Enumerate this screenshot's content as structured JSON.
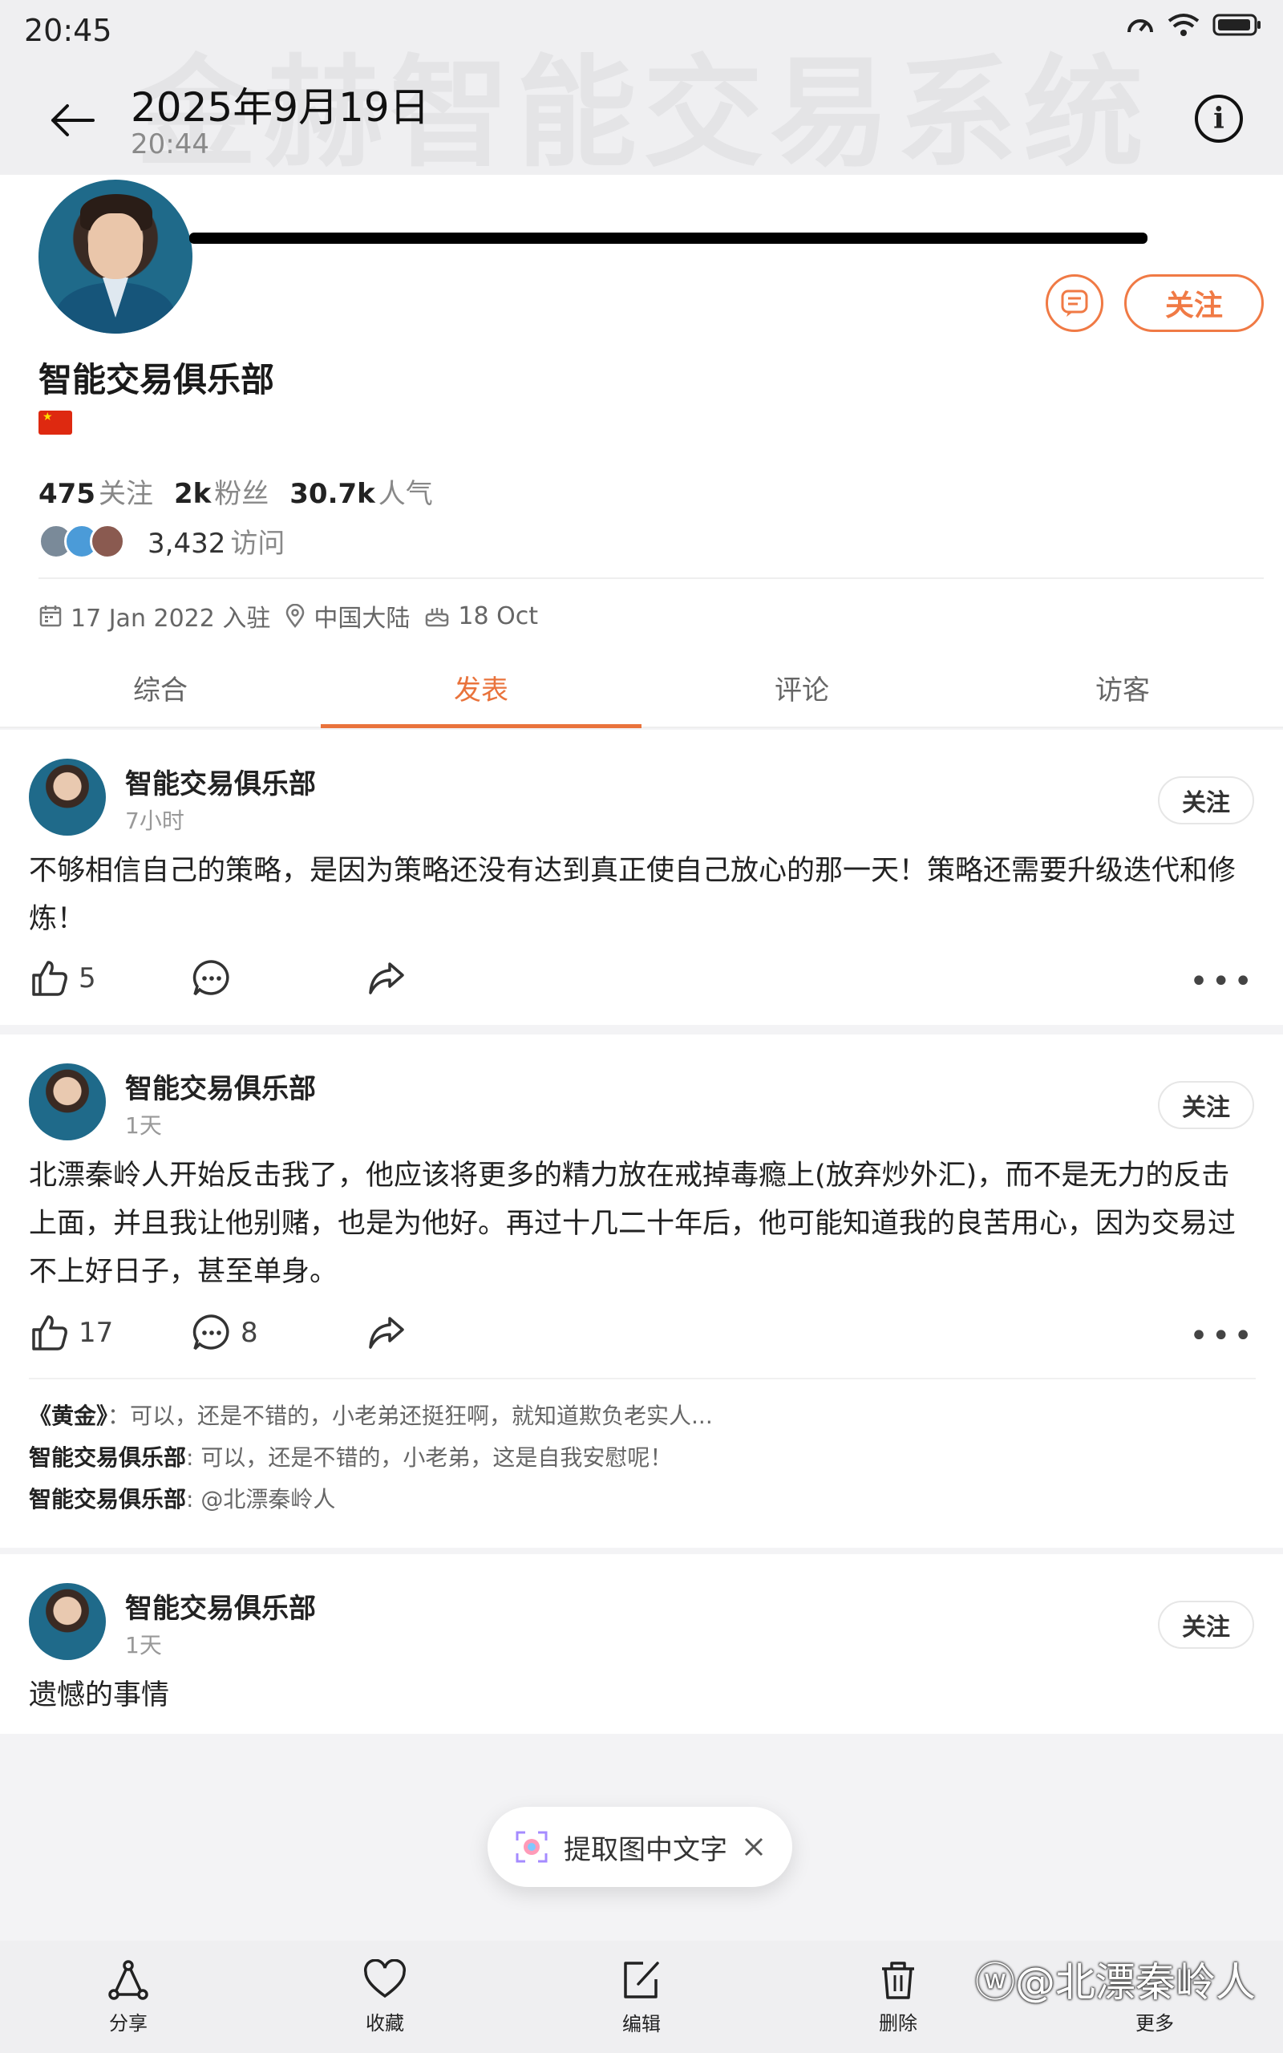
{
  "status_bar": {
    "time": "20:45"
  },
  "watermark_text": "金赫智能交易系统",
  "photo_header": {
    "date": "2025年9月19日",
    "time": "20:44"
  },
  "profile": {
    "name": "智能交易俱乐部",
    "follow_label": "关注",
    "stats": [
      {
        "value": "475",
        "label": "关注"
      },
      {
        "value": "2k",
        "label": "粉丝"
      },
      {
        "value": "30.7k",
        "label": "人气"
      }
    ],
    "visits_value": "3,432",
    "visits_label": "访问",
    "joined": "17 Jan 2022 入驻",
    "location": "中国大陆",
    "birthday": "18 Oct"
  },
  "tabs": [
    {
      "label": "综合",
      "active": false
    },
    {
      "label": "发表",
      "active": true
    },
    {
      "label": "评论",
      "active": false
    },
    {
      "label": "访客",
      "active": false
    }
  ],
  "posts": [
    {
      "author": "智能交易俱乐部",
      "time": "7小时",
      "follow_label": "关注",
      "text": "不够相信自己的策略，是因为策略还没有达到真正使自己放心的那一天！策略还需要升级迭代和修炼！",
      "likes": "5",
      "comments_count": ""
    },
    {
      "author": "智能交易俱乐部",
      "time": "1天",
      "follow_label": "关注",
      "text": "北漂秦岭人开始反击我了，他应该将更多的精力放在戒掉毒瘾上(放弃炒外汇)，而不是无力的反击上面，并且我让他别赌，也是为他好。再过十几二十年后，他可能知道我的良苦用心，因为交易过不上好日子，甚至单身。",
      "likes": "17",
      "comments_count": "8",
      "comments": [
        {
          "author": "《黄金》",
          "text": "：可以，还是不错的，小老弟还挺狂啊，就知道欺负老实人..."
        },
        {
          "author": "智能交易俱乐部",
          "text": ": 可以，还是不错的，小老弟，这是自我安慰呢！"
        },
        {
          "author": "智能交易俱乐部",
          "text": ": @北漂秦岭人"
        }
      ]
    },
    {
      "author": "智能交易俱乐部",
      "time": "1天",
      "follow_label": "关注",
      "text": "遗憾的事情"
    }
  ],
  "ocr_pill": {
    "label": "提取图中文字"
  },
  "bottom_bar": [
    {
      "label": "分享",
      "icon": "share-icon"
    },
    {
      "label": "收藏",
      "icon": "heart-icon"
    },
    {
      "label": "编辑",
      "icon": "edit-icon"
    },
    {
      "label": "删除",
      "icon": "trash-icon"
    },
    {
      "label": "更多",
      "icon": "more-icon"
    }
  ],
  "weibo_watermark": "@北漂秦岭人",
  "colors": {
    "accent": "#e9733c",
    "background": "#f3f3f5"
  }
}
